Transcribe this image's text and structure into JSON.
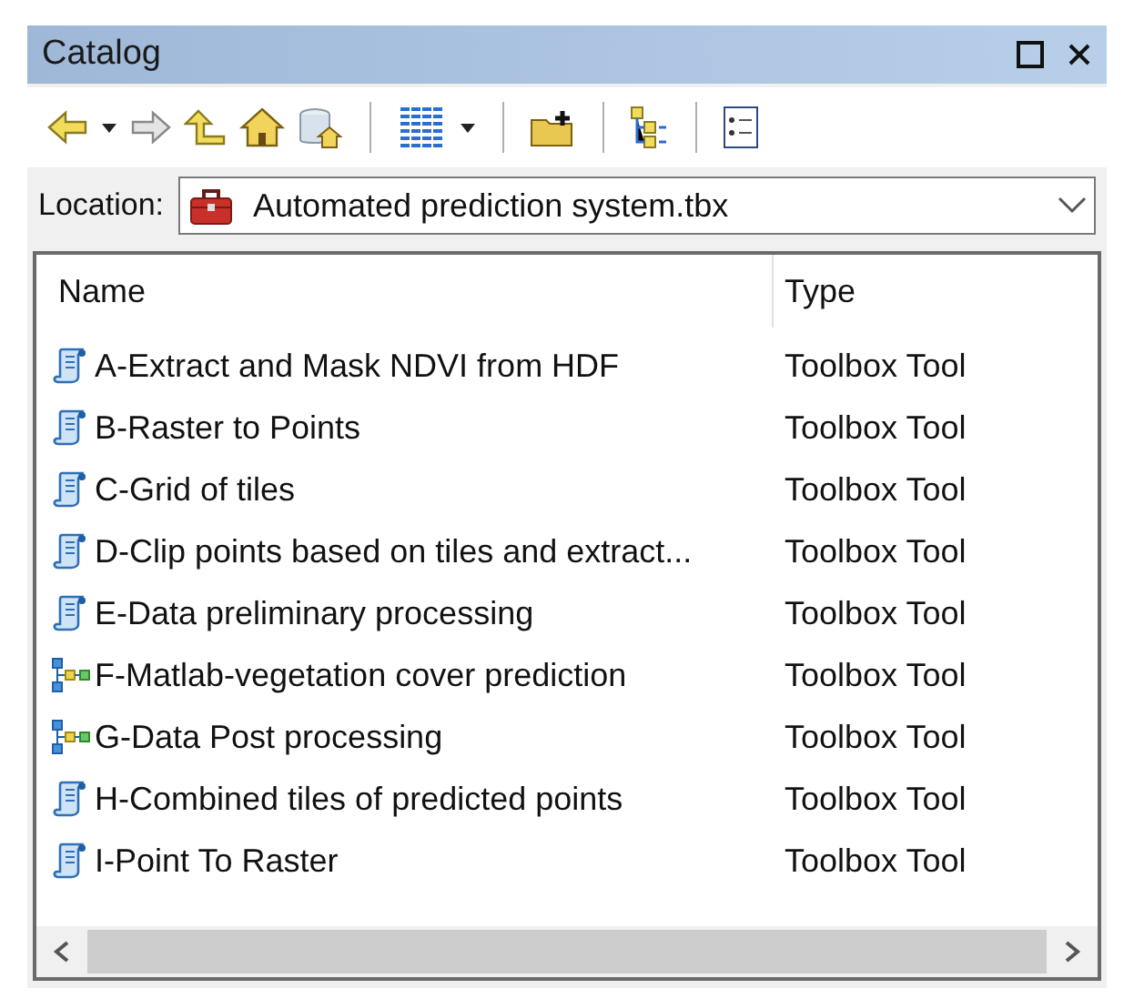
{
  "window": {
    "title": "Catalog"
  },
  "location": {
    "label": "Location:",
    "value": "Automated prediction system.tbx"
  },
  "table": {
    "columns": [
      "Name",
      "Type"
    ],
    "rows": [
      {
        "kind": "script",
        "name": "A-Extract and Mask NDVI from HDF",
        "type": "Toolbox Tool"
      },
      {
        "kind": "script",
        "name": "B-Raster to Points",
        "type": "Toolbox Tool"
      },
      {
        "kind": "script",
        "name": "C-Grid of tiles",
        "type": "Toolbox Tool"
      },
      {
        "kind": "script",
        "name": "D-Clip points based on tiles and extract...",
        "type": "Toolbox Tool"
      },
      {
        "kind": "script",
        "name": "E-Data preliminary processing",
        "type": "Toolbox Tool"
      },
      {
        "kind": "model",
        "name": "F-Matlab-vegetation cover prediction",
        "type": "Toolbox Tool"
      },
      {
        "kind": "model",
        "name": "G-Data Post processing",
        "type": "Toolbox Tool"
      },
      {
        "kind": "script",
        "name": "H-Combined tiles of predicted points",
        "type": "Toolbox Tool"
      },
      {
        "kind": "script",
        "name": "I-Point To Raster",
        "type": "Toolbox Tool"
      }
    ]
  }
}
